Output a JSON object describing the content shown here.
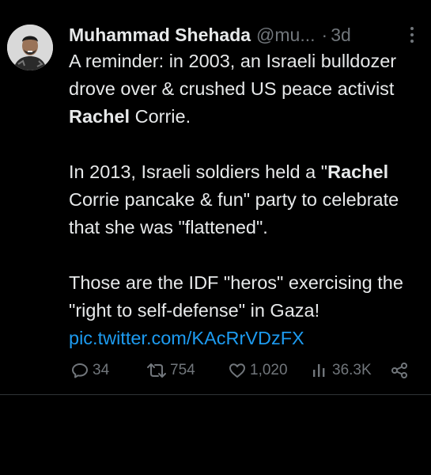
{
  "tweet": {
    "author_name": "Muhammad Shehada",
    "handle": "@mu...",
    "dot": "·",
    "time": "3d",
    "p1_before": "A reminder: in 2003, an Israeli bulldozer drove over & crushed US peace activist ",
    "p1_bold": "Rachel",
    "p1_after": " Corrie.",
    "p2_before": "In 2013, Israeli soldiers held a \"",
    "p2_bold": "Rachel",
    "p2_after": " Corrie pancake & fun\" party to celebrate that she was \"flattened\".",
    "p3": "Those are the IDF \"heros\" exercising the \"right to self-defense\" in Gaza!",
    "link": "pic.twitter.com/KAcRrVDzFX"
  },
  "actions": {
    "replies": "34",
    "reposts": "754",
    "likes": "1,020",
    "views": "36.3K"
  },
  "icons": [
    "avatar",
    "more-icon",
    "reply-icon",
    "repost-icon",
    "like-icon",
    "views-icon",
    "share-icon"
  ],
  "colors": {
    "background": "#000000",
    "text": "#e7e9ea",
    "muted": "#71767b",
    "link": "#1d9bf0"
  }
}
